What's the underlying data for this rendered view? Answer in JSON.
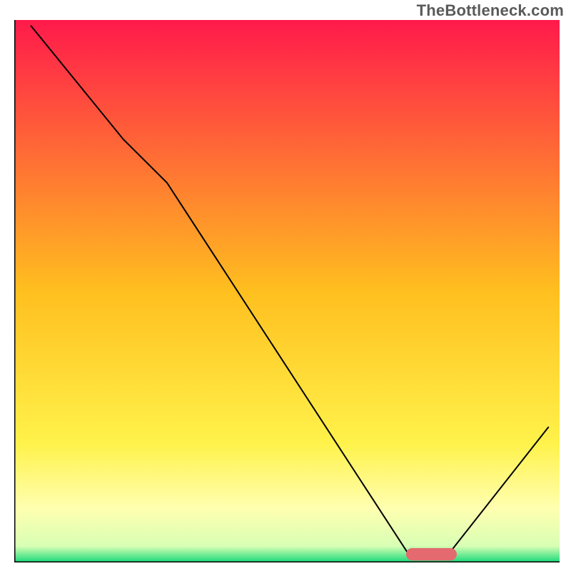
{
  "watermark": "TheBottleneck.com",
  "chart_data": {
    "type": "line",
    "title": "",
    "xlabel": "",
    "ylabel": "",
    "xlim": [
      0,
      100
    ],
    "ylim": [
      0,
      100
    ],
    "grid": false,
    "background_gradient": {
      "stops": [
        {
          "offset": 0.0,
          "color": "#ff1a4b"
        },
        {
          "offset": 0.5,
          "color": "#ffbf1f"
        },
        {
          "offset": 0.78,
          "color": "#fff24a"
        },
        {
          "offset": 0.9,
          "color": "#ffffb0"
        },
        {
          "offset": 0.97,
          "color": "#d8ffb4"
        },
        {
          "offset": 1.0,
          "color": "#17d97a"
        }
      ]
    },
    "axis_color": "#000000",
    "series": [
      {
        "name": "bottleneck-curve",
        "color": "#000000",
        "width": 2,
        "x": [
          3,
          20,
          28,
          72,
          74,
          78,
          80,
          98
        ],
        "values": [
          99,
          78,
          70,
          2,
          1,
          1,
          2,
          25
        ]
      }
    ],
    "markers": [
      {
        "name": "optimal-range",
        "shape": "capsule",
        "x_start": 73,
        "x_end": 80,
        "y": 1.5,
        "color": "#e46a6f",
        "thickness": 2.3
      }
    ]
  }
}
